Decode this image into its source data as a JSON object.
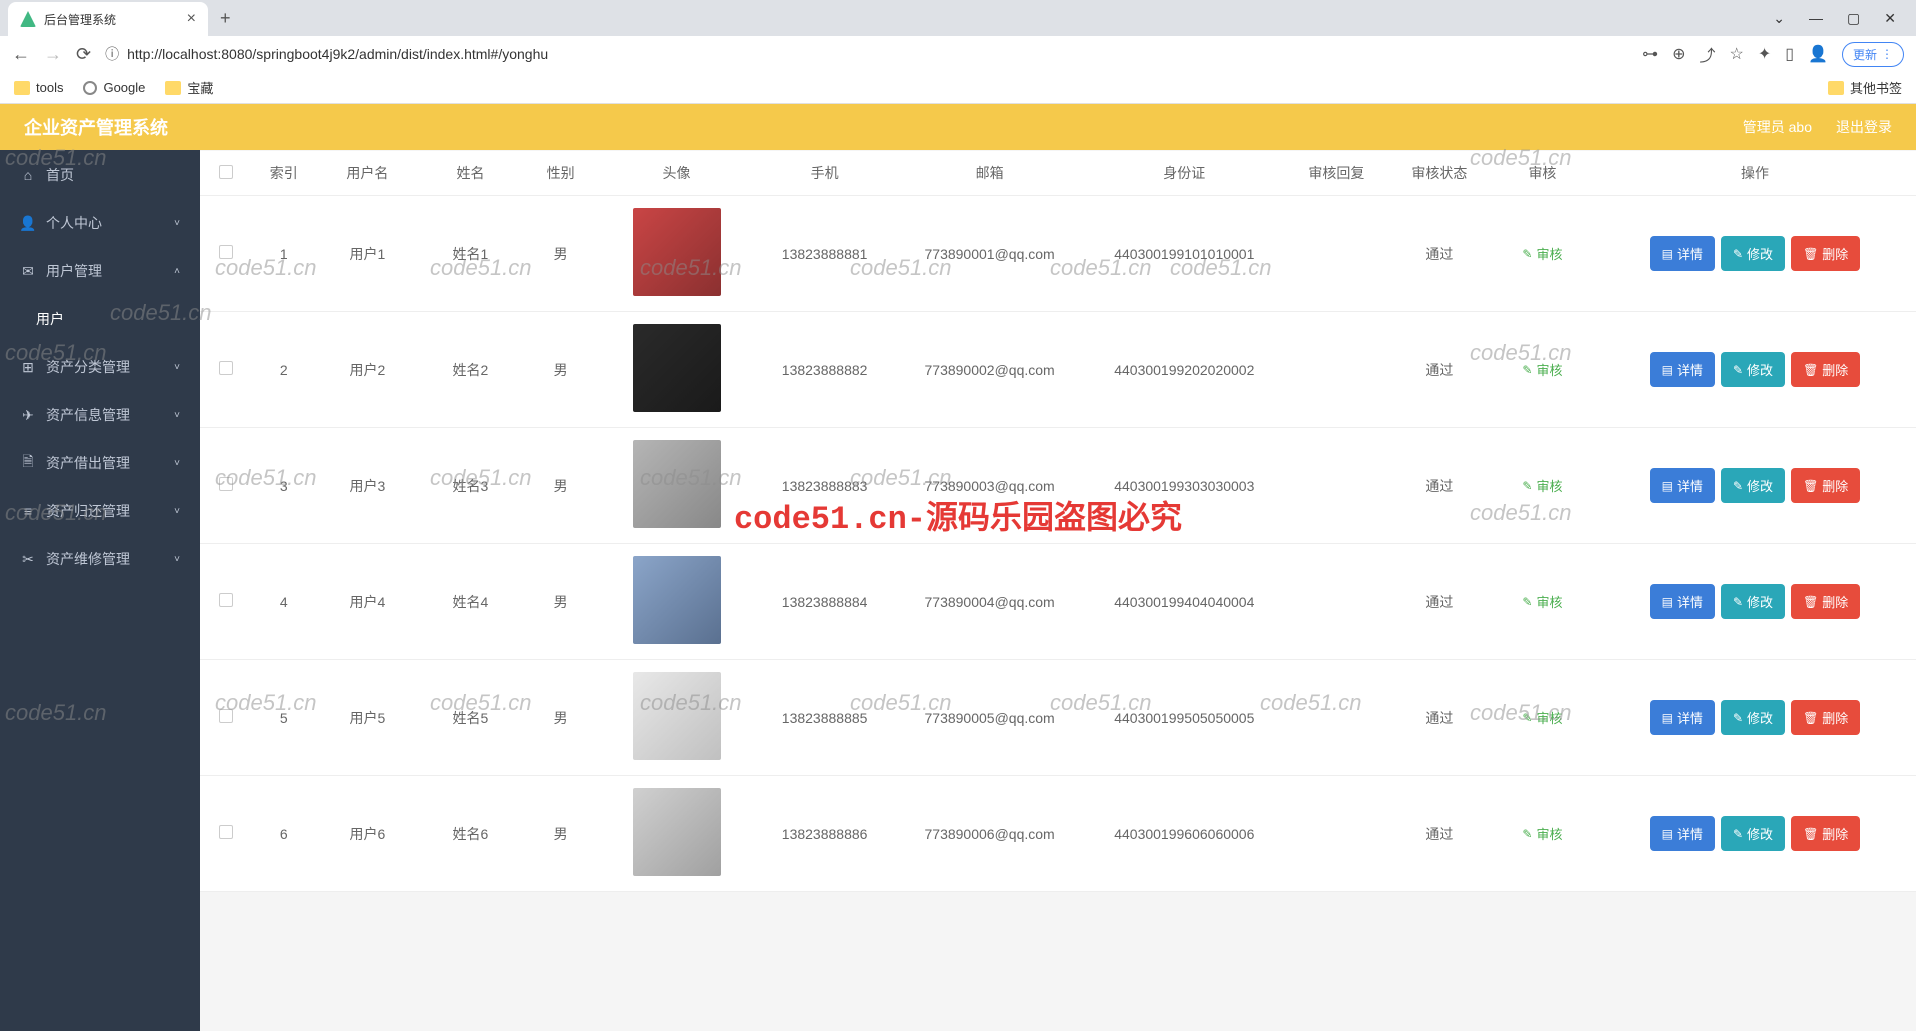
{
  "browser": {
    "tab_title": "后台管理系统",
    "url": "http://localhost:8080/springboot4j9k2/admin/dist/index.html#/yonghu",
    "update_btn": "更新",
    "bookmarks": {
      "tools": "tools",
      "google": "Google",
      "baozang": "宝藏",
      "other": "其他书签"
    }
  },
  "header": {
    "title": "企业资产管理系统",
    "admin_label": "管理员 abo",
    "logout": "退出登录"
  },
  "sidebar": {
    "items": [
      {
        "label": "首页",
        "icon": "home"
      },
      {
        "label": "个人中心",
        "icon": "user",
        "expandable": true
      },
      {
        "label": "用户管理",
        "icon": "users",
        "expandable": true,
        "expanded": true
      },
      {
        "label": "用户",
        "icon": "",
        "active": true,
        "child": true
      },
      {
        "label": "资产分类管理",
        "icon": "grid",
        "expandable": true
      },
      {
        "label": "资产信息管理",
        "icon": "send",
        "expandable": true
      },
      {
        "label": "资产借出管理",
        "icon": "file",
        "expandable": true
      },
      {
        "label": "资产归还管理",
        "icon": "list",
        "expandable": true
      },
      {
        "label": "资产维修管理",
        "icon": "wrench",
        "expandable": true
      }
    ]
  },
  "table": {
    "headers": {
      "index": "索引",
      "username": "用户名",
      "name": "姓名",
      "gender": "性别",
      "avatar": "头像",
      "phone": "手机",
      "email": "邮箱",
      "idcard": "身份证",
      "audit_reply": "审核回复",
      "audit_status": "审核状态",
      "audit": "审核",
      "actions": "操作"
    },
    "audit_label": "审核",
    "btn_detail": "详情",
    "btn_edit": "修改",
    "btn_delete": "删除",
    "rows": [
      {
        "index": "1",
        "username": "用户1",
        "name": "姓名1",
        "gender": "男",
        "phone": "13823888881",
        "email": "773890001@qq.com",
        "idcard": "440300199101010001",
        "status": "通过",
        "avatar": "avatar-1"
      },
      {
        "index": "2",
        "username": "用户2",
        "name": "姓名2",
        "gender": "男",
        "phone": "13823888882",
        "email": "773890002@qq.com",
        "idcard": "440300199202020002",
        "status": "通过",
        "avatar": "avatar-2"
      },
      {
        "index": "3",
        "username": "用户3",
        "name": "姓名3",
        "gender": "男",
        "phone": "13823888883",
        "email": "773890003@qq.com",
        "idcard": "440300199303030003",
        "status": "通过",
        "avatar": "avatar-3"
      },
      {
        "index": "4",
        "username": "用户4",
        "name": "姓名4",
        "gender": "男",
        "phone": "13823888884",
        "email": "773890004@qq.com",
        "idcard": "440300199404040004",
        "status": "通过",
        "avatar": "avatar-4"
      },
      {
        "index": "5",
        "username": "用户5",
        "name": "姓名5",
        "gender": "男",
        "phone": "13823888885",
        "email": "773890005@qq.com",
        "idcard": "440300199505050005",
        "status": "通过",
        "avatar": "avatar-5"
      },
      {
        "index": "6",
        "username": "用户6",
        "name": "姓名6",
        "gender": "男",
        "phone": "13823888886",
        "email": "773890006@qq.com",
        "idcard": "440300199606060006",
        "status": "通过",
        "avatar": "avatar-6"
      }
    ]
  },
  "watermark": {
    "main": "code51.cn-源码乐园盗图必究",
    "small": "code51.cn"
  }
}
